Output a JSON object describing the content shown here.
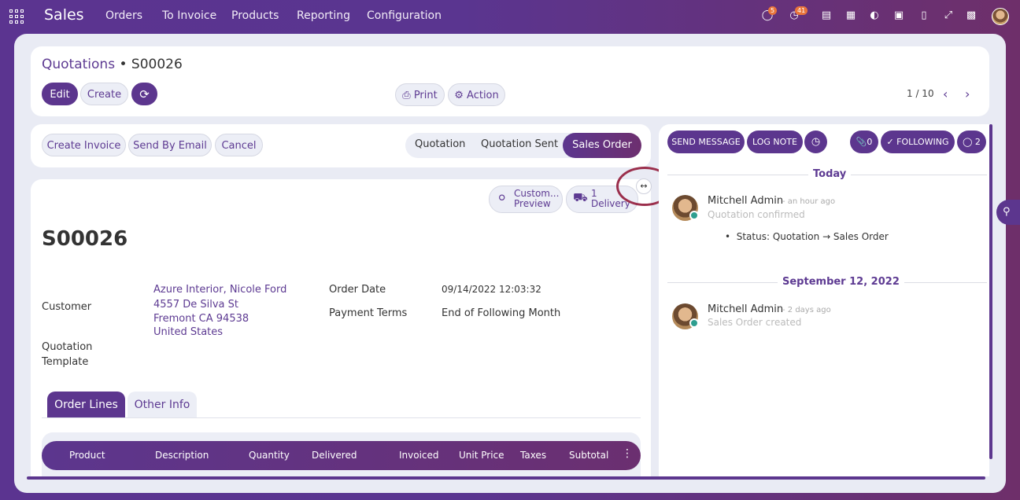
{
  "topbar": {
    "app_name": "Sales",
    "menus": [
      "Orders",
      "To Invoice",
      "Products",
      "Reporting",
      "Configuration"
    ],
    "messages_count": "5",
    "activities_count": "41"
  },
  "control_panel": {
    "breadcrumb_parent": "Quotations",
    "breadcrumb_separator": "•",
    "breadcrumb_current": "S00026",
    "edit_label": "Edit",
    "create_label": "Create",
    "print_label": "Print",
    "action_label": "Action",
    "pager": "1 / 10"
  },
  "form_header": {
    "buttons": [
      "Create Invoice",
      "Send By Email",
      "Cancel"
    ],
    "statuses": [
      "Quotation",
      "Quotation Sent",
      "Sales Order"
    ],
    "active_status": "Sales Order"
  },
  "smart_buttons": {
    "customer_preview_line1": "Custom...",
    "customer_preview_line2": "Preview",
    "delivery_count": "1",
    "delivery_label": "Delivery"
  },
  "record": {
    "name": "S00026",
    "customer_label": "Customer",
    "customer_name": "Azure Interior, Nicole Ford",
    "customer_street": "4557 De Silva St",
    "customer_city": "Fremont CA 94538",
    "customer_country": "United States",
    "quotation_template_label_1": "Quotation",
    "quotation_template_label_2": "Template",
    "order_date_label": "Order Date",
    "order_date": "09/14/2022 12:03:32",
    "payment_terms_label": "Payment Terms",
    "payment_terms": "End of Following Month"
  },
  "tabs": [
    "Order Lines",
    "Other Info"
  ],
  "table": {
    "columns": [
      "Product",
      "Description",
      "Quantity",
      "Delivered",
      "Invoiced",
      "Unit Price",
      "Taxes",
      "Subtotal"
    ]
  },
  "chatter": {
    "send_message": "SEND MESSAGE",
    "log_note": "LOG NOTE",
    "attachments": "0",
    "following": "FOLLOWING",
    "followers": "2",
    "groups": [
      {
        "date": "Today",
        "author": "Mitchell Admin",
        "time": "- an hour ago",
        "body": "Quotation confirmed",
        "tracking": "Status: Quotation → Sales Order"
      },
      {
        "date": "September 12, 2022",
        "author": "Mitchell Admin",
        "time": "- 2 days ago",
        "body": "Sales Order created"
      }
    ]
  },
  "colors": {
    "primary": "#5c368e",
    "accent_ring": "#9b2f4c",
    "status_online": "#2e9e8f"
  }
}
